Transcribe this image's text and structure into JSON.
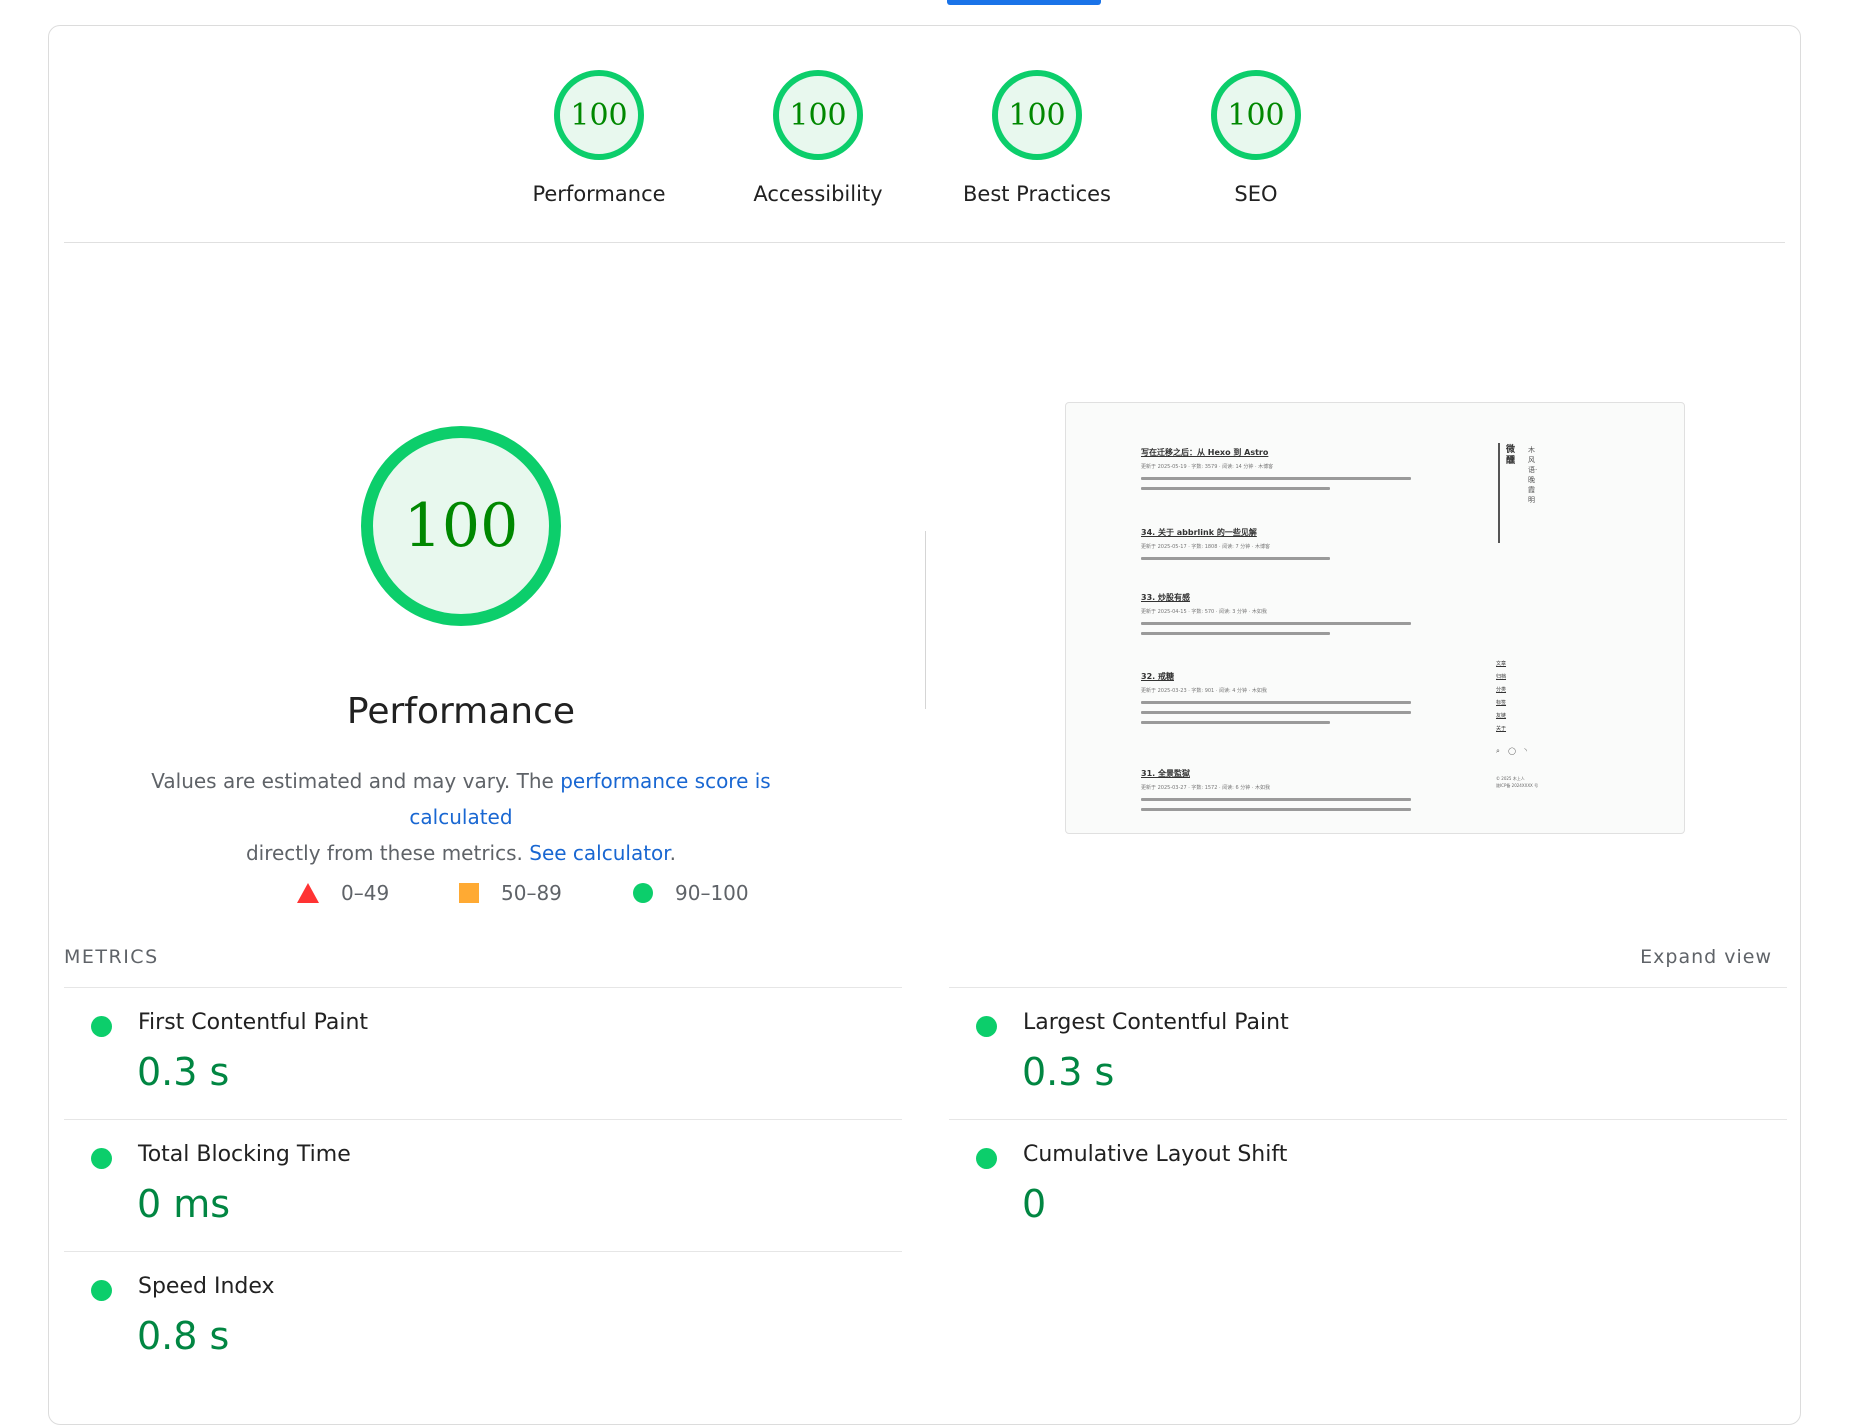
{
  "gauges": [
    {
      "score": "100",
      "label": "Performance"
    },
    {
      "score": "100",
      "label": "Accessibility"
    },
    {
      "score": "100",
      "label": "Best Practices"
    },
    {
      "score": "100",
      "label": "SEO"
    }
  ],
  "main": {
    "score": "100",
    "title": "Performance",
    "desc_prefix": "Values are estimated and may vary. The ",
    "desc_link1": "performance score is calculated",
    "desc_middle": "directly from these metrics. ",
    "desc_link2": "See calculator",
    "desc_suffix": "."
  },
  "legend": [
    {
      "shape": "triangle",
      "range": "0–49",
      "color": "#ff3333"
    },
    {
      "shape": "square",
      "range": "50–89",
      "color": "#ffaa33"
    },
    {
      "shape": "circle",
      "range": "90–100",
      "color": "#0cce6b"
    }
  ],
  "thumbnail": {
    "articles": [
      {
        "title": "写在迁移之后：从 Hexo 到 Astro",
        "meta": "更新于 2025-05-19 · 字数: 3579 · 阅读: 14 分钟 · 木博客"
      },
      {
        "title": "34. 关于 abbrlink 的一些见解",
        "meta": "更新于 2025-05-17 · 字数: 1808 · 阅读: 7 分钟 · 木博客"
      },
      {
        "title": "33. 炒股有感",
        "meta": "更新于 2025-04-15 · 字数: 570 · 阅读: 3 分钟 · 木如我"
      },
      {
        "title": "32. 戒糖",
        "meta": "更新于 2025-03-23 · 字数: 901 · 阅读: 4 分钟 · 木如我"
      },
      {
        "title": "31. 全景監獄",
        "meta": "更新于 2025-03-27 · 字数: 1572 · 阅读: 6 分钟 · 木如我"
      }
    ],
    "site_name": "微醺",
    "site_motto": "木风语·晚霞明",
    "nav": [
      "文章",
      "归档",
      "分类",
      "标签",
      "友链",
      "关于"
    ],
    "icons": "⌕ ◯ ◝",
    "footer": [
      "© 2025 木上人",
      "陇ICP备 2024XXXX 号"
    ]
  },
  "metrics": {
    "header": "METRICS",
    "expand_label": "Expand view",
    "items": [
      {
        "label": "First Contentful Paint",
        "value": "0.3 s",
        "status_color": "#0cce6b"
      },
      {
        "label": "Largest Contentful Paint",
        "value": "0.3 s",
        "status_color": "#0cce6b"
      },
      {
        "label": "Total Blocking Time",
        "value": "0 ms",
        "status_color": "#0cce6b"
      },
      {
        "label": "Cumulative Layout Shift",
        "value": "0",
        "status_color": "#0cce6b"
      },
      {
        "label": "Speed Index",
        "value": "0.8 s",
        "status_color": "#0cce6b"
      }
    ]
  },
  "colors": {
    "pass": "#0cce6b",
    "pass_text": "#018642",
    "link": "#1967d2",
    "tab_indicator": "#1a73e8"
  }
}
